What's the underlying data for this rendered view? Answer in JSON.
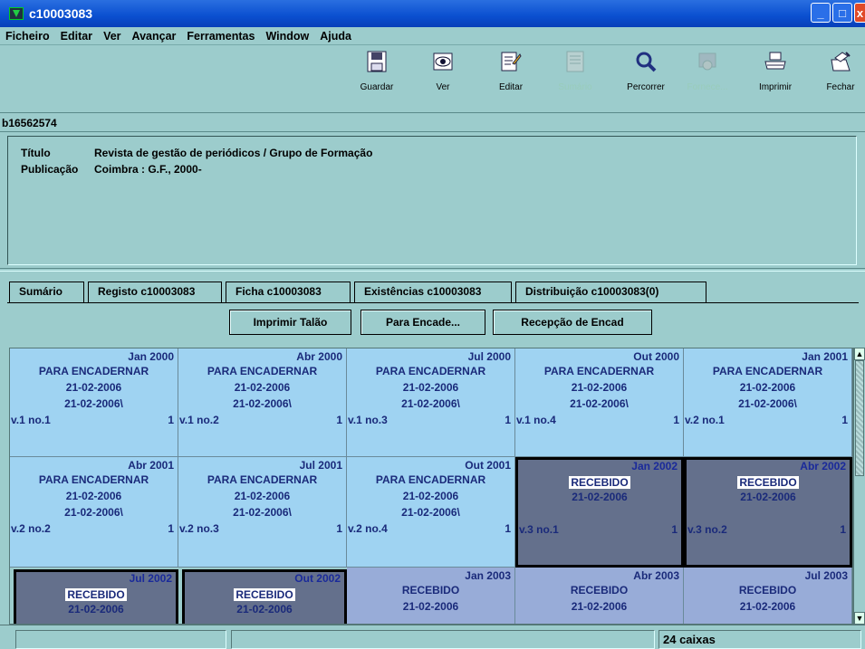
{
  "window": {
    "title": "c10003083"
  },
  "menu": [
    "Ficheiro",
    "Editar",
    "Ver",
    "Avançar",
    "Ferramentas",
    "Window",
    "Ajuda"
  ],
  "toolbar": {
    "guardar": "Guardar",
    "ver": "Ver",
    "editar": "Editar",
    "sumario": "Sumário",
    "percorrer": "Percorrer",
    "fornece": "Fornece...",
    "imprimir": "Imprimir",
    "fechar": "Fechar"
  },
  "record_id": "b16562574",
  "info": {
    "titulo_label": "Título",
    "titulo_value": "Revista de gestão de periódicos / Grupo de Formação",
    "publicacao_label": "Publicação",
    "publicacao_value": "Coimbra : G.F., 2000-"
  },
  "tabs": [
    "Sumário",
    "Registo c10003083",
    "Ficha c10003083",
    "Existências c10003083",
    "Distribuição c10003083(0)"
  ],
  "buttons": {
    "imprimir_talao": "Imprimir Talão",
    "para_encade": "Para Encade...",
    "recepcao": "Recepção de Encad"
  },
  "cells": [
    {
      "date": "Jan 2000",
      "s": "PARA ENCADERNAR",
      "d1": "21-02-2006",
      "d2": "21-02-2006\\",
      "vol": "v.1 no.1",
      "n": "1"
    },
    {
      "date": "Abr 2000",
      "s": "PARA ENCADERNAR",
      "d1": "21-02-2006",
      "d2": "21-02-2006\\",
      "vol": "v.1 no.2",
      "n": "1"
    },
    {
      "date": "Jul 2000",
      "s": "PARA ENCADERNAR",
      "d1": "21-02-2006",
      "d2": "21-02-2006\\",
      "vol": "v.1 no.3",
      "n": "1"
    },
    {
      "date": "Out 2000",
      "s": "PARA ENCADERNAR",
      "d1": "21-02-2006",
      "d2": "21-02-2006\\",
      "vol": "v.1 no.4",
      "n": "1"
    },
    {
      "date": "Jan 2001",
      "s": "PARA ENCADERNAR",
      "d1": "21-02-2006",
      "d2": "21-02-2006\\",
      "vol": "v.2 no.1",
      "n": "1"
    },
    {
      "date": "Abr 2001",
      "s": "PARA ENCADERNAR",
      "d1": "21-02-2006",
      "d2": "21-02-2006\\",
      "vol": "v.2 no.2",
      "n": "1"
    },
    {
      "date": "Jul 2001",
      "s": "PARA ENCADERNAR",
      "d1": "21-02-2006",
      "d2": "21-02-2006\\",
      "vol": "v.2 no.3",
      "n": "1"
    },
    {
      "date": "Out 2001",
      "s": "PARA ENCADERNAR",
      "d1": "21-02-2006",
      "d2": "21-02-2006\\",
      "vol": "v.2 no.4",
      "n": "1"
    },
    {
      "date": "Jan 2002",
      "s": "RECEBIDO",
      "d1": "21-02-2006",
      "vol": "v.3 no.1",
      "n": "1"
    },
    {
      "date": "Abr 2002",
      "s": "RECEBIDO",
      "d1": "21-02-2006",
      "vol": "v.3 no.2",
      "n": "1"
    },
    {
      "date": "Jul 2002",
      "s": "RECEBIDO",
      "d1": "21-02-2006"
    },
    {
      "date": "Out 2002",
      "s": "RECEBIDO",
      "d1": "21-02-2006"
    },
    {
      "date": "Jan 2003",
      "s": "RECEBIDO",
      "d1": "21-02-2006"
    },
    {
      "date": "Abr 2003",
      "s": "RECEBIDO",
      "d1": "21-02-2006"
    },
    {
      "date": "Jul 2003",
      "s": "RECEBIDO",
      "d1": "21-02-2006"
    }
  ],
  "status": {
    "caixas": "24 caixas"
  }
}
